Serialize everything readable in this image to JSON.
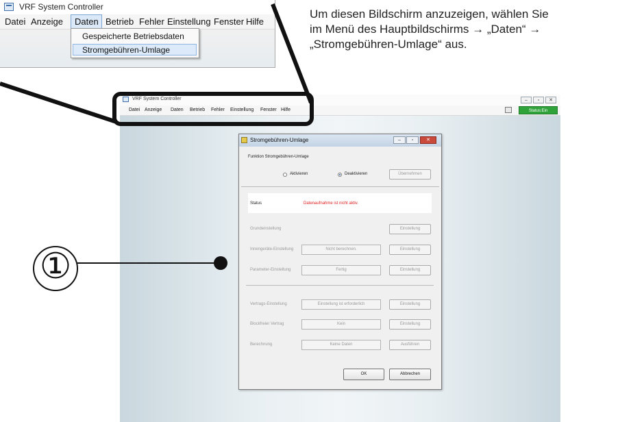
{
  "zoom": {
    "title": "VRF System Controller",
    "menu": [
      "Datei",
      "Anzeige",
      "Daten",
      "Betrieb",
      "Fehler",
      "Einstellung",
      "Fenster",
      "Hilfe"
    ],
    "dropdown": [
      "Gespeicherte Betriebsdaten",
      "Stromgebühren-Umlage"
    ]
  },
  "instruction": "Um diesen Bildschirm anzuzeigen, wählen Sie\nim Menü des Hauptbildschirms → „Daten“ →\n„Stromgebühren-Umlage“ aus.",
  "callout_number": "①",
  "app": {
    "title": "VRF System Controller",
    "menu": [
      "Datei",
      "Anzeige",
      "Daten",
      "Betrieb",
      "Fehler",
      "Einstellung",
      "Fenster",
      "Hilfe"
    ],
    "status_button": "Status:Ein",
    "window_buttons": [
      "–",
      "▫",
      "✕"
    ]
  },
  "dialog": {
    "title": "Stromgebühren-Umlage",
    "window_buttons": [
      "–",
      "▫",
      "✕"
    ],
    "function_label": "Funktion Stromgebühren-Umlage",
    "radio_activate": "Aktivieren",
    "radio_deactivate": "Deaktivieren",
    "radio_selected": "Deaktivieren",
    "apply_button": "Übernehmen",
    "status_label": "Status",
    "status_value": "Datenaufnahme ist nicht aktiv.",
    "rows": [
      {
        "label": "Grundeinstellung",
        "field": null,
        "button": "Einstellung"
      },
      {
        "label": "Innengeräte-Einstellung",
        "field": "Nicht berechnen.",
        "button": "Einstellung"
      },
      {
        "label": "Parameter-Einstellung",
        "field": "Fertig",
        "button": "Einstellung"
      },
      {
        "label": "Vertrags-Einstellung",
        "field": "Einstellung ist erforderlich",
        "button": "Einstellung"
      },
      {
        "label": "Blockfreier Vertrag",
        "field": "Kein",
        "button": "Einstellung"
      },
      {
        "label": "Berechnung",
        "field": "Keine Daten",
        "button": "Ausführen"
      }
    ],
    "ok_button": "OK",
    "cancel_button": "Abbrechen"
  }
}
